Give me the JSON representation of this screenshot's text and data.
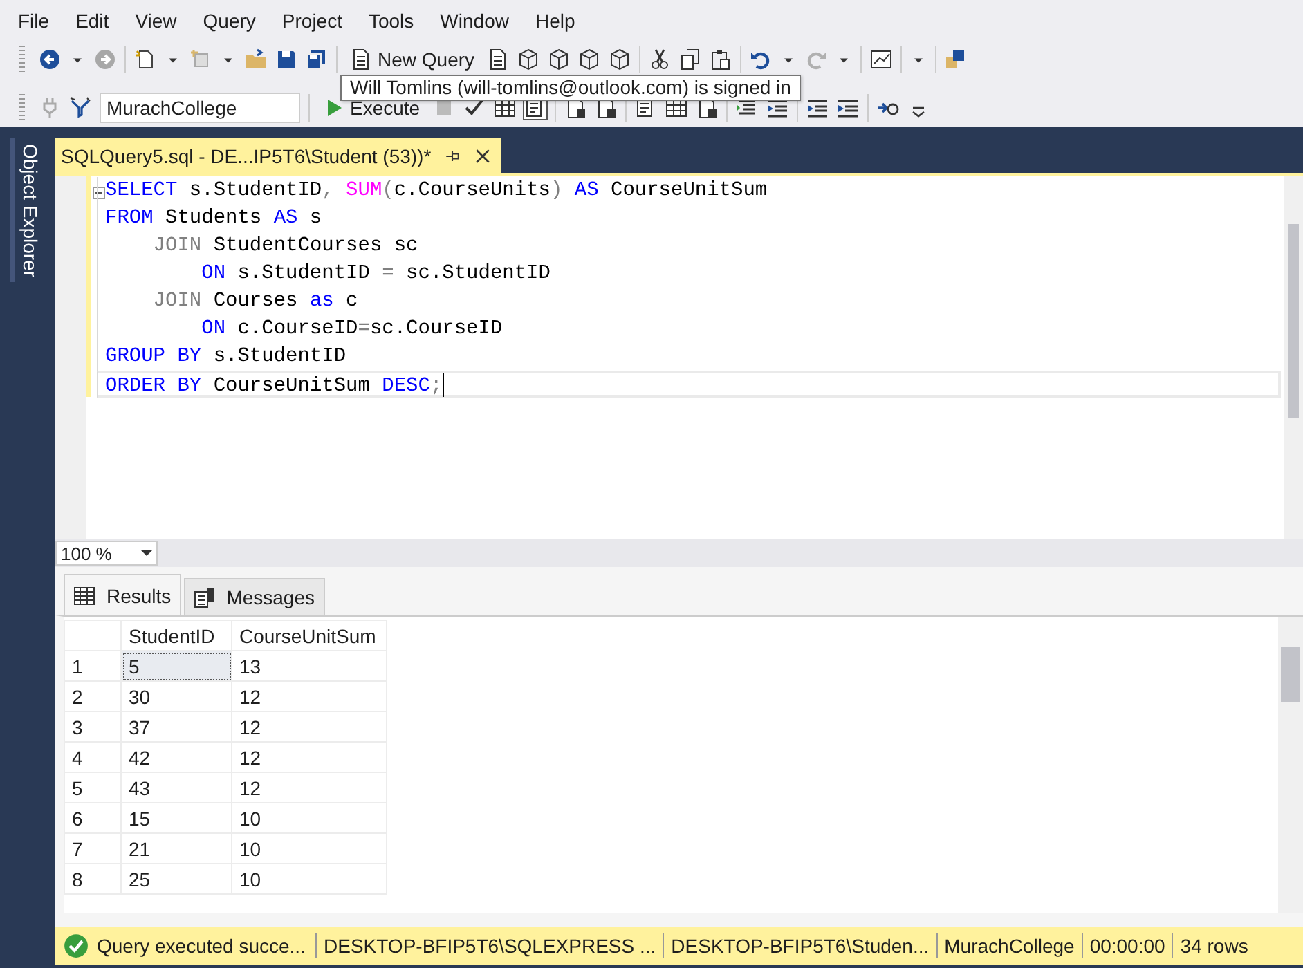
{
  "menu": [
    "File",
    "Edit",
    "View",
    "Query",
    "Project",
    "Tools",
    "Window",
    "Help"
  ],
  "toolbar": {
    "new_query": "New Query",
    "database": "MurachCollege",
    "execute": "Execute"
  },
  "tooltip": "Will Tomlins (will-tomlins@outlook.com) is signed in",
  "side_tab": "Object Explorer",
  "document_tab": {
    "title": "SQLQuery5.sql - DE...IP5T6\\Student (53))*",
    "selected": true
  },
  "editor": {
    "lines": [
      {
        "current": false,
        "tokens": [
          {
            "text": "SELECT",
            "kind": "keyword"
          },
          {
            "text": " s.StudentID",
            "kind": "name"
          },
          {
            "text": ", ",
            "kind": "symbol"
          },
          {
            "text": "SUM",
            "kind": "function"
          },
          {
            "text": "(",
            "kind": "symbol"
          },
          {
            "text": "c.CourseUnits",
            "kind": "name"
          },
          {
            "text": ")",
            "kind": "symbol"
          },
          {
            "text": " AS",
            "kind": "keyword"
          },
          {
            "text": " CourseUnitSum",
            "kind": "name"
          }
        ]
      },
      {
        "current": false,
        "tokens": [
          {
            "text": "FROM",
            "kind": "keyword"
          },
          {
            "text": " Students ",
            "kind": "name"
          },
          {
            "text": "AS",
            "kind": "keyword"
          },
          {
            "text": " s",
            "kind": "name"
          }
        ]
      },
      {
        "current": false,
        "tokens": [
          {
            "text": "    JOIN",
            "kind": "symbol"
          },
          {
            "text": " StudentCourses sc",
            "kind": "name"
          }
        ]
      },
      {
        "current": false,
        "tokens": [
          {
            "text": "        ON",
            "kind": "keyword"
          },
          {
            "text": " s.StudentID ",
            "kind": "name"
          },
          {
            "text": "=",
            "kind": "symbol"
          },
          {
            "text": " sc.StudentID",
            "kind": "name"
          }
        ]
      },
      {
        "current": false,
        "tokens": [
          {
            "text": "    JOIN",
            "kind": "symbol"
          },
          {
            "text": " Courses ",
            "kind": "name"
          },
          {
            "text": "as",
            "kind": "keyword"
          },
          {
            "text": " c",
            "kind": "name"
          }
        ]
      },
      {
        "current": false,
        "tokens": [
          {
            "text": "        ON",
            "kind": "keyword"
          },
          {
            "text": " c.CourseID",
            "kind": "name"
          },
          {
            "text": "=",
            "kind": "symbol"
          },
          {
            "text": "sc.CourseID",
            "kind": "name"
          }
        ]
      },
      {
        "current": false,
        "tokens": [
          {
            "text": "GROUP BY",
            "kind": "keyword"
          },
          {
            "text": " s.StudentID",
            "kind": "name"
          }
        ]
      },
      {
        "current": true,
        "tokens": [
          {
            "text": "ORDER BY",
            "kind": "keyword"
          },
          {
            "text": " CourseUnitSum ",
            "kind": "name"
          },
          {
            "text": "DESC",
            "kind": "keyword"
          },
          {
            "text": ";",
            "kind": "symbol"
          }
        ]
      }
    ]
  },
  "zoom": "100 %",
  "result_tabs": [
    {
      "label": "Results",
      "selected": true
    },
    {
      "label": "Messages",
      "selected": false
    }
  ],
  "grid": {
    "columns": [
      "StudentID",
      "CourseUnitSum"
    ],
    "rows": [
      {
        "number": "1",
        "cells": [
          "5",
          "13"
        ],
        "selected": true
      },
      {
        "number": "2",
        "cells": [
          "30",
          "12"
        ],
        "selected": false
      },
      {
        "number": "3",
        "cells": [
          "37",
          "12"
        ],
        "selected": false
      },
      {
        "number": "4",
        "cells": [
          "42",
          "12"
        ],
        "selected": false
      },
      {
        "number": "5",
        "cells": [
          "43",
          "12"
        ],
        "selected": false
      },
      {
        "number": "6",
        "cells": [
          "15",
          "10"
        ],
        "selected": false
      },
      {
        "number": "7",
        "cells": [
          "21",
          "10"
        ],
        "selected": false
      },
      {
        "number": "8",
        "cells": [
          "25",
          "10"
        ],
        "selected": false
      }
    ]
  },
  "status": {
    "message": "Query executed succe...",
    "segments": [
      "DESKTOP-BFIP5T6\\SQLEXPRESS ...",
      "DESKTOP-BFIP5T6\\Studen...",
      "MurachCollege",
      "00:00:00",
      "34 rows"
    ]
  }
}
